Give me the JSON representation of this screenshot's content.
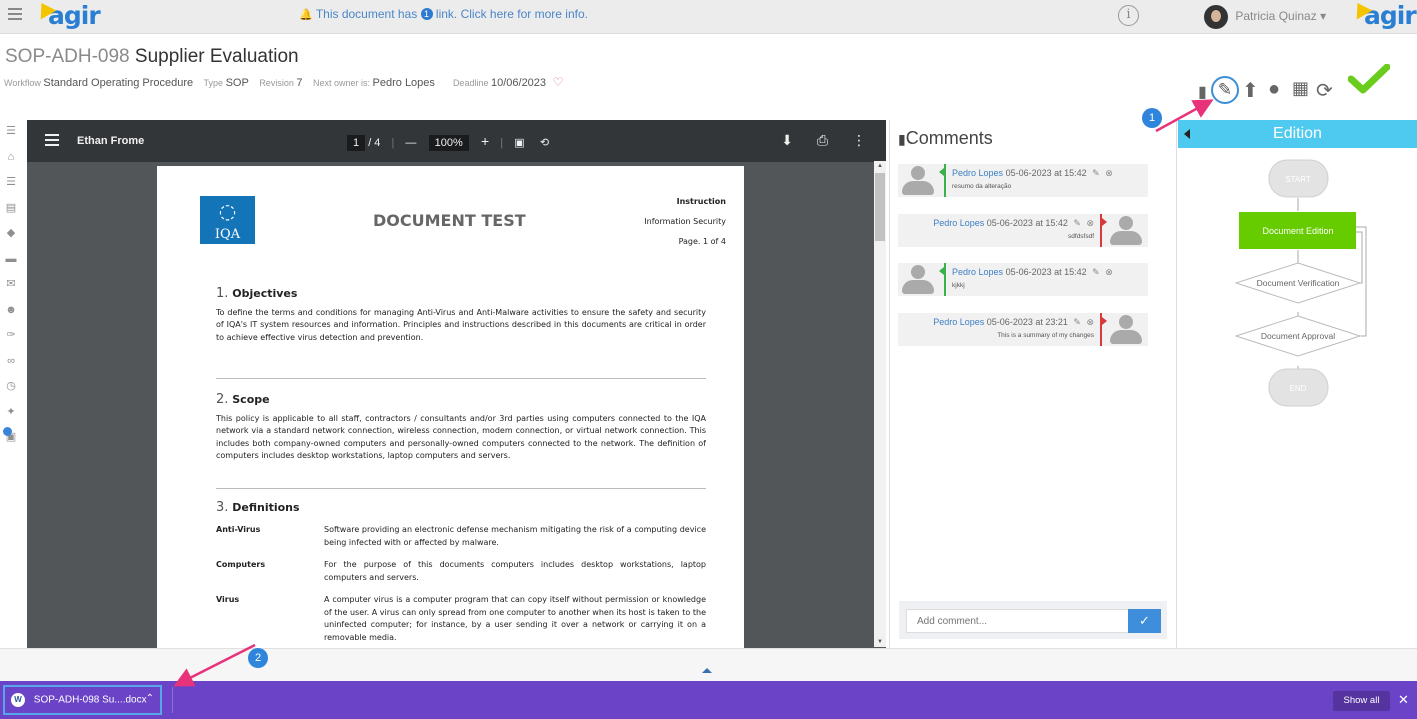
{
  "topbar": {
    "logo": "agir",
    "notice_prefix": "This document has",
    "notice_count": "1",
    "notice_suffix": "link. Click here for more info.",
    "user_name": "Patricia Quinaz"
  },
  "header": {
    "code": "SOP-ADH-098",
    "title": "Supplier Evaluation",
    "meta": {
      "workflow_label": "Workflow",
      "workflow": "Standard Operating Procedure",
      "type_label": "Type",
      "type": "SOP",
      "revision_label": "Revision",
      "revision": "7",
      "next_owner_label": "Next owner is:",
      "next_owner": "Pedro Lopes",
      "deadline_label": "Deadline",
      "deadline": "10/06/2023"
    }
  },
  "pdf": {
    "file_name": "Ethan Frome",
    "page_current": "1",
    "page_total": "/ 4",
    "zoom": "100%",
    "doc": {
      "title": "DOCUMENT TEST",
      "logo_text": "IQA",
      "head_type": "Instruction",
      "head_area": "Information Security",
      "head_page": "Page. 1 of 4",
      "sections": [
        {
          "num": "1.",
          "title": "Objectives",
          "text": "To define the terms and conditions for managing Anti-Virus and Anti-Malware activities to ensure the safety and security of IQA's IT system resources and information. Principles and instructions described in this documents are critical in order to achieve effective virus detection and prevention."
        },
        {
          "num": "2.",
          "title": "Scope",
          "text": "This policy is applicable to all staff, contractors / consultants and/or 3rd parties using computers connected to the IQA network via a standard network connection, wireless connection, modem connection, or virtual network connection. This includes both company-owned computers and personally-owned computers connected to the network. The definition of computers includes desktop workstations, laptop computers and servers."
        },
        {
          "num": "3.",
          "title": "Definitions",
          "text": ""
        }
      ],
      "definitions": [
        {
          "term": "Anti-Virus",
          "desc": "Software providing an electronic defense mechanism mitigating the risk of a computing device being infected with or affected by malware."
        },
        {
          "term": "Computers",
          "desc": "For the purpose of this documents computers includes desktop workstations, laptop computers and servers."
        },
        {
          "term": "Virus",
          "desc": "A computer virus is a computer program that can copy itself without permission or knowledge of the user. A virus can only spread from one computer to another when its host is taken to the uninfected computer; for instance, by a user sending it over a network or carrying it on a removable media."
        }
      ]
    }
  },
  "comments": {
    "title": "Comments",
    "items": [
      {
        "author": "Pedro Lopes",
        "date": "05-06-2023 at 15:42",
        "text": "resumo da alteração",
        "side": "left"
      },
      {
        "author": "Pedro Lopes",
        "date": "05-06-2023 at 15:42",
        "text": "sdfdsfsdf",
        "side": "right"
      },
      {
        "author": "Pedro Lopes",
        "date": "05-06-2023 at 15:42",
        "text": "kjkkj",
        "side": "left"
      },
      {
        "author": "Pedro Lopes",
        "date": "05-06-2023 at 23:21",
        "text": "This is a summary of my changes",
        "side": "right"
      }
    ],
    "add_placeholder": "Add comment..."
  },
  "edition": {
    "title": "Edition",
    "nodes": [
      "START",
      "Document Edition",
      "Document Verification",
      "Document Approval",
      "END"
    ],
    "active_node": "Document Edition",
    "active_color": "#66cc00"
  },
  "download_bar": {
    "file_name": "SOP-ADH-098 Su....docx",
    "show_all": "Show all"
  },
  "annotations": [
    "1",
    "2"
  ],
  "colors": {
    "accent": "#2f85dc",
    "download_bar": "#6a43c6",
    "edition_header": "#4ec9ef",
    "check": "#6acd1e",
    "arrow": "#e8337a"
  }
}
